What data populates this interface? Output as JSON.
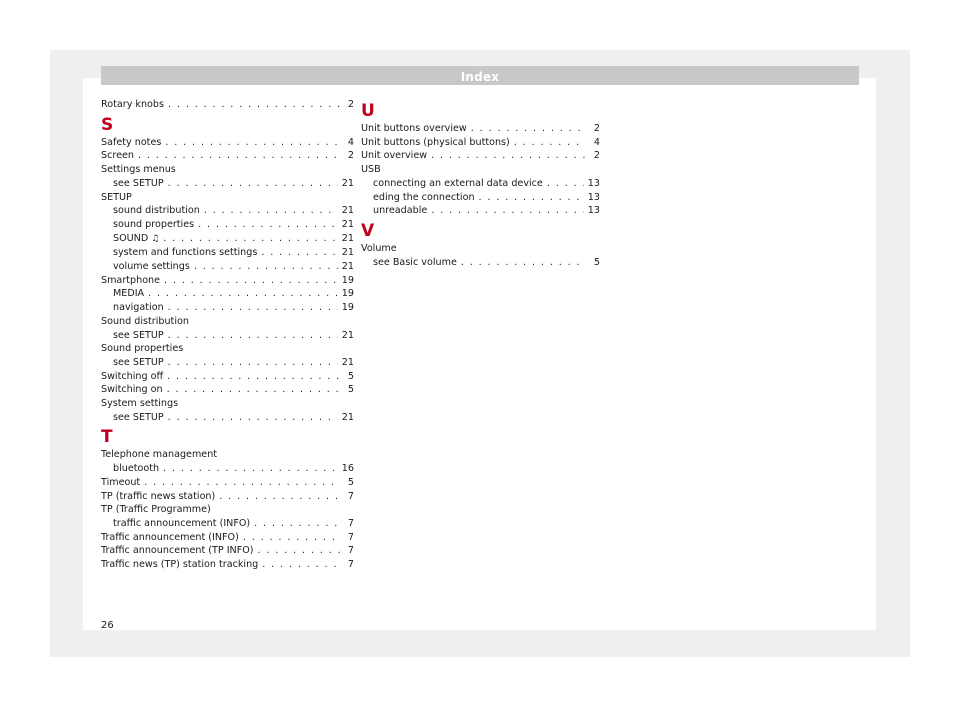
{
  "header": {
    "title": "Index"
  },
  "page_number": "26",
  "left": {
    "top_entry": {
      "text": "Rotary knobs",
      "page": "2"
    },
    "section_s": {
      "letter": "S",
      "safety_notes": {
        "text": "Safety notes",
        "page": "4"
      },
      "screen": {
        "text": "Screen",
        "page": "2"
      },
      "settings_menus": {
        "text": "Settings menus",
        "sub": {
          "text": "see SETUP",
          "page": "21"
        }
      },
      "setup": {
        "text": "SETUP",
        "subs": [
          {
            "text": "sound distribution",
            "page": "21"
          },
          {
            "text": "sound properties",
            "page": "21"
          },
          {
            "text": "SOUND",
            "page": "21"
          },
          {
            "text": "system and functions settings",
            "page": "21"
          },
          {
            "text": "volume settings",
            "page": "21"
          }
        ]
      },
      "smartphone": {
        "text": "Smartphone",
        "page": "19",
        "subs": [
          {
            "text": "MEDIA",
            "page": "19"
          },
          {
            "text": "navigation",
            "page": "19"
          }
        ]
      },
      "sound_distribution": {
        "text": "Sound distribution",
        "sub": {
          "text": "see SETUP",
          "page": "21"
        }
      },
      "sound_properties": {
        "text": "Sound properties",
        "sub": {
          "text": "see SETUP",
          "page": "21"
        }
      },
      "switching_off": {
        "text": "Switching off",
        "page": "5"
      },
      "switching_on": {
        "text": "Switching on",
        "page": "5"
      },
      "system_settings": {
        "text": "System settings",
        "sub": {
          "text": "see SETUP",
          "page": "21"
        }
      }
    },
    "section_t": {
      "letter": "T",
      "telephone": {
        "text": "Telephone management",
        "sub": {
          "text": "bluetooth",
          "page": "16"
        }
      },
      "timeout": {
        "text": "Timeout",
        "page": "5"
      },
      "tp": {
        "text": "TP (traffic news station)",
        "page": "7"
      },
      "tp_programme": {
        "text": "TP (Traffic Programme)",
        "sub": {
          "text": "traffic announcement (INFO)",
          "page": "7"
        }
      },
      "traffic_info": {
        "text": "Traffic announcement (INFO)",
        "page": "7"
      },
      "traffic_tp_info": {
        "text": "Traffic announcement (TP INFO)",
        "page": "7"
      },
      "traffic_news": {
        "text": "Traffic news (TP) station tracking",
        "page": "7"
      }
    }
  },
  "right": {
    "section_u": {
      "letter": "U",
      "unit_buttons_overview": {
        "text": "Unit buttons overview",
        "page": "2"
      },
      "unit_buttons_physical": {
        "text": "Unit buttons (physical buttons)",
        "page": "4"
      },
      "unit_overview": {
        "text": "Unit overview",
        "page": "2"
      },
      "usb": {
        "text": "USB",
        "subs": [
          {
            "text": "connecting an external data device",
            "page": "13"
          },
          {
            "text": "eding the connection",
            "page": "13"
          },
          {
            "text": "unreadable",
            "page": "13"
          }
        ]
      }
    },
    "section_v": {
      "letter": "V",
      "volume": {
        "text": "Volume",
        "sub": {
          "text": "see Basic volume",
          "page": "5"
        }
      }
    }
  }
}
